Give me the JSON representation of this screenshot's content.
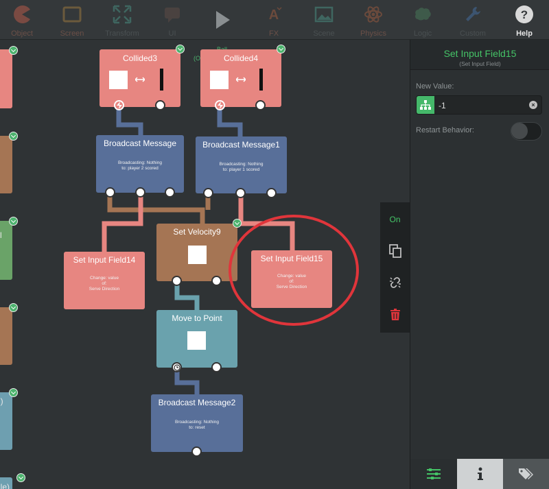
{
  "toolbar": {
    "items": [
      {
        "label": "Object",
        "icon": "pacman-icon"
      },
      {
        "label": "Screen",
        "icon": "screen-icon"
      },
      {
        "label": "Transform",
        "icon": "transform-icon"
      },
      {
        "label": "UI",
        "icon": "speech-bubble-icon"
      },
      {
        "label": "",
        "icon": "play-icon"
      },
      {
        "label": "FX",
        "icon": "fx-icon"
      },
      {
        "label": "Scene",
        "icon": "image-icon"
      },
      {
        "label": "Physics",
        "icon": "atom-icon"
      },
      {
        "label": "Logic",
        "icon": "brain-icon"
      },
      {
        "label": "Custom",
        "icon": "wrench-icon"
      },
      {
        "label": "Help",
        "icon": "help-icon"
      }
    ]
  },
  "canvas": {
    "ghost_label": "Ball",
    "ghost_label2": "(Ob",
    "edge_labels": {
      "l1": "l",
      "l2": "l)",
      "l3": "lle)"
    },
    "nodes": {
      "collided3": {
        "title": "Collided3"
      },
      "collided4": {
        "title": "Collided4"
      },
      "bm1": {
        "title": "Broadcast Message",
        "line1": "Broadcasting: Nothing",
        "line2": "to: player 2 scored"
      },
      "bm2": {
        "title": "Broadcast Message1",
        "line1": "Broadcasting: Nothing",
        "line2": "to: player 1 scored"
      },
      "sv": {
        "title": "Set Velocity9"
      },
      "sif14": {
        "title": "Set Input Field14",
        "line1": "Change: value",
        "line2": "of:",
        "line3": "Serve Direction"
      },
      "sif15": {
        "title": "Set Input Field15",
        "line1": "Change: value",
        "line2": "of:",
        "line3": "Serve Direction"
      },
      "mtp": {
        "title": "Move to Point"
      },
      "bm3": {
        "title": "Broadcast Message2",
        "line1": "Broadcasting: Nothing",
        "line2": "to: reset"
      }
    }
  },
  "side_palette": {
    "on_label": "On",
    "icons": [
      "copy-icon",
      "unlink-icon",
      "trash-icon"
    ]
  },
  "panel": {
    "title": "Set Input Field15",
    "subtitle": "(Set Input Field)",
    "new_value_label": "New Value:",
    "new_value": "-1",
    "restart_label": "Restart Behavior:",
    "restart_on": false,
    "tabs": [
      "sliders-icon",
      "info-icon",
      "tags-icon"
    ]
  },
  "colors": {
    "accent_green": "#45c467",
    "highlight_circle": "#e0353b",
    "salmon": "#e78681",
    "navy": "#586f99",
    "brown": "#a57554",
    "teal": "#6aa2ad"
  }
}
